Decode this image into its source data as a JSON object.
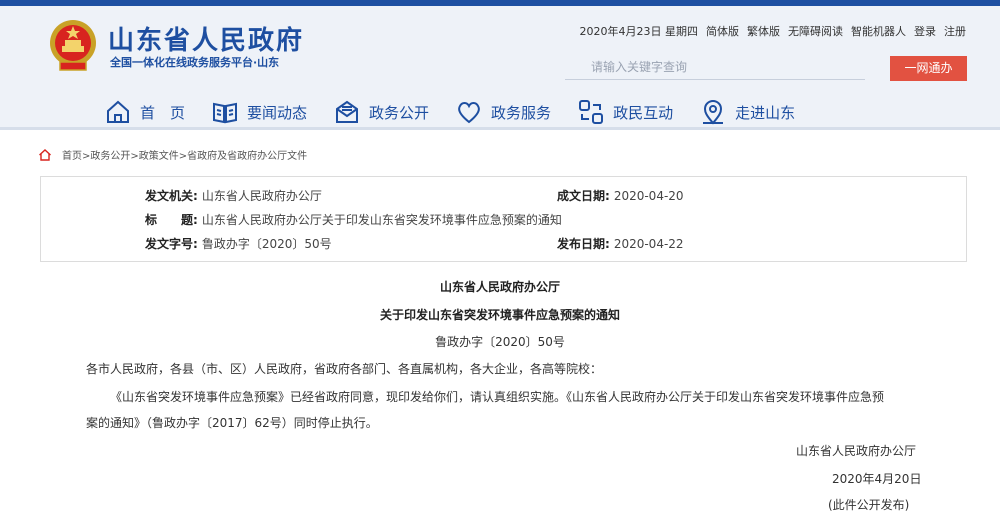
{
  "header": {
    "site_title": "山东省人民政府",
    "site_subtitle": "全国一体化在线政务服务平台·山东",
    "date": "2020年4月23日 星期四",
    "links": [
      "简体版",
      "繁体版",
      "无障碍阅读",
      "智能机器人",
      "登录",
      "注册"
    ],
    "search_placeholder": "请输入关键字查询",
    "one_net_button": "一网通办"
  },
  "nav": [
    {
      "label": "首　页",
      "icon": "home-icon"
    },
    {
      "label": "要闻动态",
      "icon": "book-icon"
    },
    {
      "label": "政务公开",
      "icon": "mail-icon"
    },
    {
      "label": "政务服务",
      "icon": "heart-icon"
    },
    {
      "label": "政民互动",
      "icon": "interact-icon"
    },
    {
      "label": "走进山东",
      "icon": "location-icon"
    }
  ],
  "breadcrumb": "首页>政务公开>政策文件>省政府及省政府办公厅文件",
  "meta": {
    "issuer_label": "发文机关:",
    "issuer": "山东省人民政府办公厅",
    "made_label": "成文日期:",
    "made_date": "2020-04-20",
    "title_label": "标　　题:",
    "title": "山东省人民政府办公厅关于印发山东省突发环境事件应急预案的通知",
    "docno_label": "发文字号:",
    "docno": "鲁政办字〔2020〕50号",
    "publish_label": "发布日期:",
    "publish_date": "2020-04-22"
  },
  "doc": {
    "org": "山东省人民政府办公厅",
    "title": "关于印发山东省突发环境事件应急预案的通知",
    "number": "鲁政办字〔2020〕50号",
    "addressee": "各市人民政府，各县（市、区）人民政府，省政府各部门、各直属机构，各大企业，各高等院校：",
    "body_line1": "《山东省突发环境事件应急预案》已经省政府同意，现印发给你们，请认真组织实施。《山东省人民政府办公厅关于印发山东省突发环境事件应急预",
    "body_line2": "案的通知》（鲁政办字〔2017〕62号）同时停止执行。",
    "sign_org": "山东省人民政府办公厅",
    "sign_date": "2020年4月20日",
    "note": "(此件公开发布)"
  }
}
